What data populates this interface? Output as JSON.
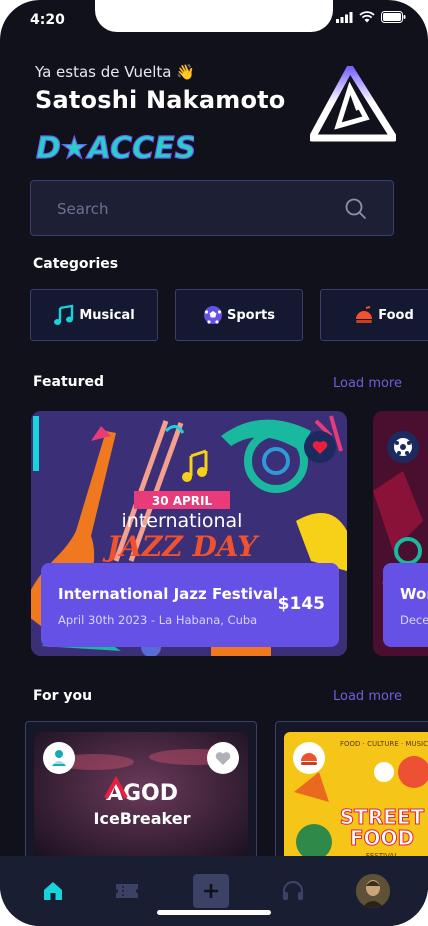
{
  "status_bar": {
    "time": "4:20"
  },
  "header": {
    "greeting": "Ya estas de Vuelta 👋",
    "user_name": "Satoshi Nakamoto",
    "brand_wordmark": "D★ACCESS"
  },
  "search": {
    "placeholder": "Search"
  },
  "categories": {
    "title": "Categories",
    "items": [
      {
        "label": "Musical",
        "icon": "music-note-icon",
        "color": "#19d3dc"
      },
      {
        "label": "Sports",
        "icon": "soccer-ball-icon",
        "color": "#6651e6"
      },
      {
        "label": "Food",
        "icon": "food-icon",
        "color": "#f0522d"
      }
    ]
  },
  "featured": {
    "title": "Featured",
    "load_more": "Load more",
    "cards": [
      {
        "banner_date": "30 APRIL",
        "banner_line1": "international",
        "banner_line2": "JAZZ DAY",
        "title": "International Jazz Festival",
        "subtitle": "April 30th 2023 - La Habana, Cuba",
        "price": "$145"
      },
      {
        "title": "Wor",
        "subtitle": "Dece"
      }
    ]
  },
  "for_you": {
    "title": "For you",
    "load_more": "Load more",
    "cards": [
      {
        "brand": "AGOD",
        "title": "IceBreaker"
      },
      {
        "line1": "STREET",
        "line2": "FOOD",
        "line3": "FESTIVAL",
        "arc": "FOOD · CULTURE · MUSIC"
      }
    ]
  },
  "colors": {
    "background": "#11111b",
    "accent": "#6651e6",
    "cyan": "#19d3dc"
  },
  "tab_bar": {
    "items": [
      "home-icon",
      "ticket-icon",
      "add-icon",
      "headphones-icon",
      "avatar"
    ]
  }
}
